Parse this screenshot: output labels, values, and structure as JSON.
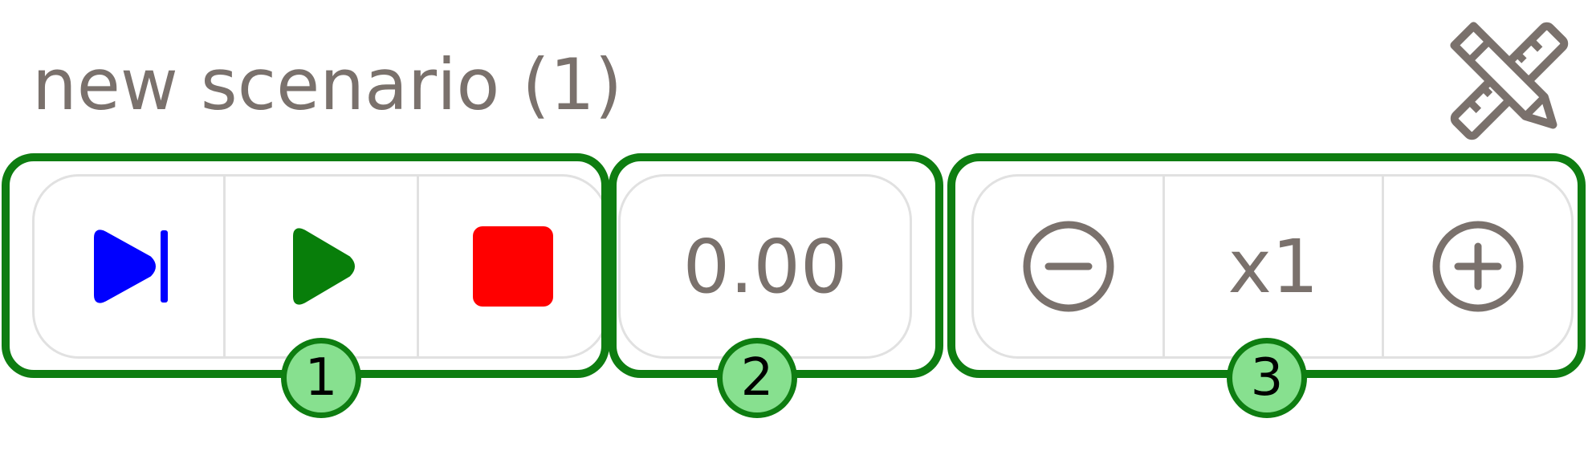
{
  "header": {
    "title": "new scenario (1)",
    "edit_icon": "pencil-ruler-icon"
  },
  "playback_controls": {
    "buttons": [
      {
        "name": "step-forward",
        "icon": "step-forward-icon",
        "color": "#0000ff"
      },
      {
        "name": "play",
        "icon": "play-icon",
        "color": "#087e0a"
      },
      {
        "name": "stop",
        "icon": "stop-icon",
        "color": "#ff0000"
      }
    ]
  },
  "time_display": {
    "value": "0.00"
  },
  "speed_controls": {
    "decrease_icon": "minus-circle-icon",
    "speed_label": "x1",
    "increase_icon": "plus-circle-icon"
  },
  "callouts": [
    {
      "number": "1"
    },
    {
      "number": "2"
    },
    {
      "number": "3"
    }
  ],
  "colors": {
    "highlight_border": "#0e7d11",
    "badge_fill": "#87e08f",
    "text_gray": "#7a716c",
    "control_border": "#e1e1e1"
  }
}
